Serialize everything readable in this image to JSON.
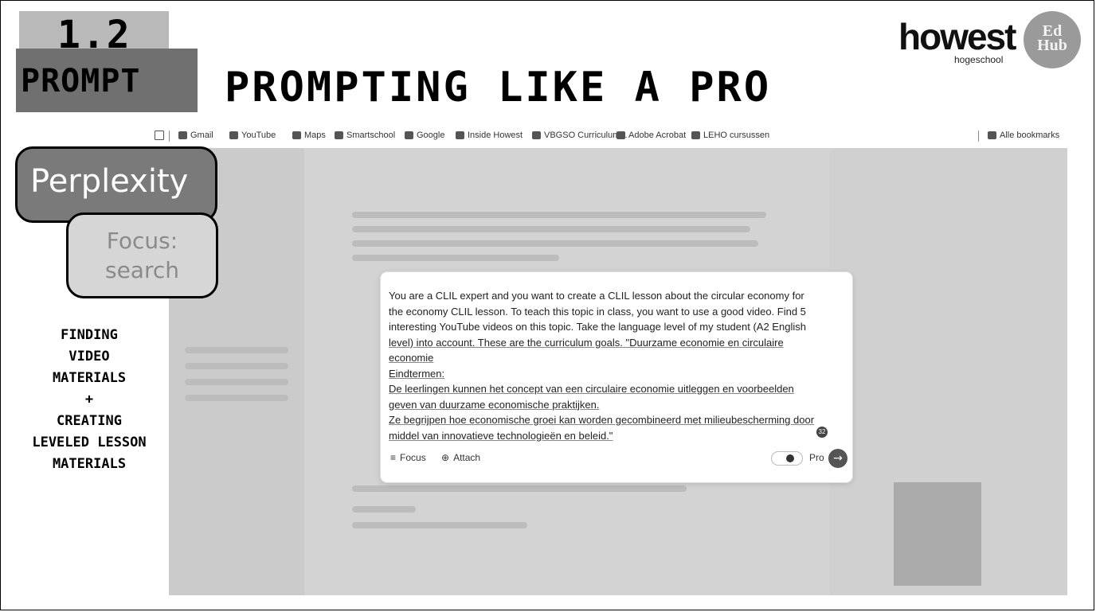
{
  "slide": {
    "badge_number": "1.2",
    "badge_word": "PROMPT",
    "title": "PROMPTING LIKE A PRO",
    "logo_text": "howest",
    "logo_sub": "hogeschool",
    "edhub_text": "Ed Hub"
  },
  "bookmarks": {
    "items": [
      "Gmail",
      "YouTube",
      "Maps",
      "Smartschool",
      "Google",
      "Inside Howest",
      "VBGSO Curriculum...",
      "Adobe Acrobat",
      "LEHO cursussen"
    ],
    "all_label": "Alle bookmarks"
  },
  "labels": {
    "app_name": "Perplexity",
    "focus_line1": "Focus:",
    "focus_line2": "search",
    "side_lines": [
      "FINDING",
      "VIDEO",
      "MATERIALS",
      "+",
      "CREATING",
      "LEVELED LESSON",
      "MATERIALS"
    ]
  },
  "prompt": {
    "line1": "You are a CLIL expert and you want to create a CLIL lesson about the circular economy for",
    "line2": "the economy CLIL lesson. To teach this topic in class, you want to use a good video. Find 5",
    "line3": "interesting YouTube videos on this topic. Take the language level of my student (A2 English",
    "line4": "level) into account. These are the curriculum goals. \"Duurzame economie en circulaire",
    "line5": "economie",
    "line6": "Eindtermen:",
    "line7": "De leerlingen kunnen het concept van een circulaire economie uitleggen en voorbeelden",
    "line8": "geven van duurzame economische praktijken.",
    "line9": "Ze begrijpen hoe economische groei kan worden gecombineerd met milieubescherming door",
    "line10": "middel van innovatieve technologieën en beleid.\"",
    "counter": "32",
    "focus_label": "Focus",
    "attach_label": "Attach",
    "pro_label": "Pro"
  }
}
